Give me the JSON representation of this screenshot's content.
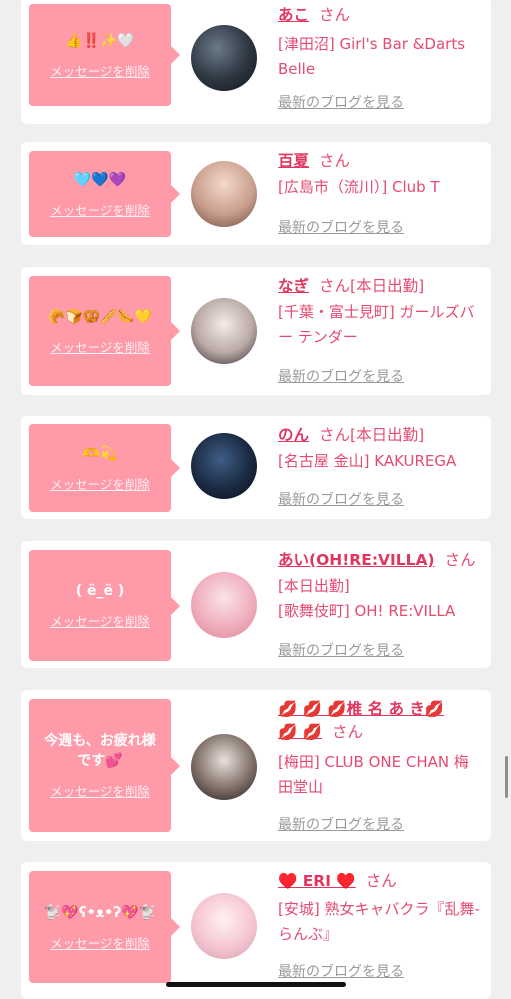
{
  "delete_label": "メッセージを削除",
  "blog_label": "最新のブログを見る",
  "san_label": "さん",
  "colors": {
    "bubble": "#ff9aa9",
    "name": "#e0365f",
    "text": "#e74a71",
    "link_gray": "#9a9a9a",
    "background": "#efeff0"
  },
  "cards": [
    {
      "message": "👍‼️✨🤍",
      "name": "あこ",
      "extra": "",
      "shop": "[津田沼] Girl's Bar &Darts Belle"
    },
    {
      "message": "🩵💙💜",
      "name": "百夏",
      "extra": "",
      "shop": "[広島市（流川）] Club T"
    },
    {
      "message": "🥐🍞🥨🥖🌭💛",
      "name": "なぎ",
      "extra": "[本日出勤]",
      "shop": "[千葉・富士見町] ガールズバー テンダー"
    },
    {
      "message": "🫶💫",
      "name": "のん",
      "extra": "[本日出勤]",
      "shop": "[名古屋 金山] KAKUREGA"
    },
    {
      "message": "( ё_ё )",
      "name": "あい(OH!RE:VILLA)",
      "extra": "",
      "shop": "[本日出勤]\n[歌舞伎町] OH! RE:VILLA"
    },
    {
      "message": "今週も、お疲れ様\nです💕",
      "name": "💋 💋 💋椎 名 あ き💋\n💋 💋",
      "extra": "",
      "shop": "[梅田] CLUB ONE CHAN 梅田堂山"
    },
    {
      "message": "🐩💖ʕ•ᴥ•ʔ💖🐩",
      "name": "♥️ ERI ♥️",
      "extra": "",
      "shop": "[安城] 熟女キャバクラ『乱舞-らんぶ』"
    }
  ]
}
